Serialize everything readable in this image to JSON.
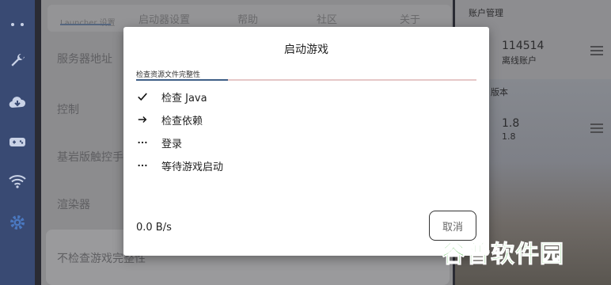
{
  "background": {
    "tabs": [
      "Launcher 设置",
      "启动器设置",
      "帮助",
      "社区",
      "关于"
    ],
    "labels": [
      "服务器地址",
      "控制",
      "基岩版触控手",
      "渲染器",
      "不检查游戏完整性"
    ],
    "right_header": "账户管理",
    "accounts": [
      {
        "name": "114514",
        "type": "离线账户"
      },
      {
        "name": "1.8",
        "type": "1.8"
      }
    ],
    "versions_header": "版本"
  },
  "dialog": {
    "title": "启动游戏",
    "current_task": "检查资源文件完整性",
    "progress": 0.27,
    "steps": [
      {
        "status": "done",
        "label": "检查 Java"
      },
      {
        "status": "in-progress",
        "label": "检查依赖"
      },
      {
        "status": "pending",
        "label": "登录"
      },
      {
        "status": "pending",
        "label": "等待游戏启动"
      }
    ],
    "speed": "0.0 B/s",
    "cancel_label": "取消"
  },
  "watermark": "谷普软件园",
  "colors": {
    "rail": "#394a73",
    "progress": "#3f5f86",
    "watermark": "#3fae3a"
  }
}
